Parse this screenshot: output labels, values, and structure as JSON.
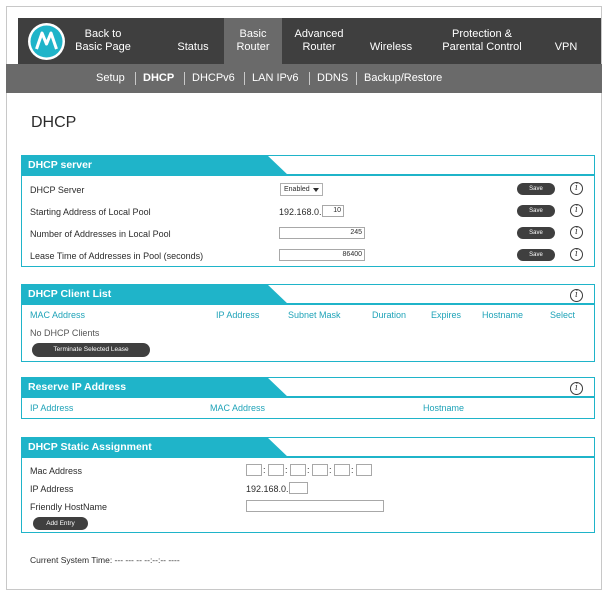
{
  "nav": {
    "back": "Back to\nBasic Page",
    "status": "Status",
    "basic_router": "Basic\nRouter",
    "advanced_router": "Advanced\nRouter",
    "wireless": "Wireless",
    "protection": "Protection &\nParental Control",
    "vpn": "VPN"
  },
  "subnav": {
    "setup": "Setup",
    "dhcp": "DHCP",
    "dhcpv6": "DHCPv6",
    "lan_ipv6": "LAN IPv6",
    "ddns": "DDNS",
    "backup_restore": "Backup/Restore"
  },
  "page_title": "DHCP",
  "dhcp_server": {
    "title": "DHCP server",
    "server_label": "DHCP Server",
    "server_value": "Enabled",
    "start_label": "Starting Address of Local Pool",
    "start_prefix": "192.168.0.",
    "start_value": "10",
    "count_label": "Number of Addresses in Local Pool",
    "count_value": "245",
    "lease_label": "Lease Time of Addresses in Pool (seconds)",
    "lease_value": "86400",
    "save_label": "Save"
  },
  "client_list": {
    "title": "DHCP Client List",
    "columns": [
      "MAC Address",
      "IP Address",
      "Subnet Mask",
      "Duration",
      "Expires",
      "Hostname",
      "Select"
    ],
    "empty_text": "No DHCP Clients",
    "terminate_label": "Terminate Selected Lease"
  },
  "reserve_ip": {
    "title": "Reserve IP Address",
    "columns": [
      "IP Address",
      "MAC Address",
      "Hostname"
    ]
  },
  "static_assignment": {
    "title": "DHCP Static Assignment",
    "mac_label": "Mac Address",
    "ip_label": "IP Address",
    "ip_prefix": "192.168.0.",
    "host_label": "Friendly HostName",
    "add_label": "Add Entry"
  },
  "system_time": "Current System Time: --- --- -- --:--:-- ----",
  "colors": {
    "accent": "#1fb4c9",
    "nav_bg": "#3f3f3f",
    "nav_active": "#6a6a6a"
  }
}
